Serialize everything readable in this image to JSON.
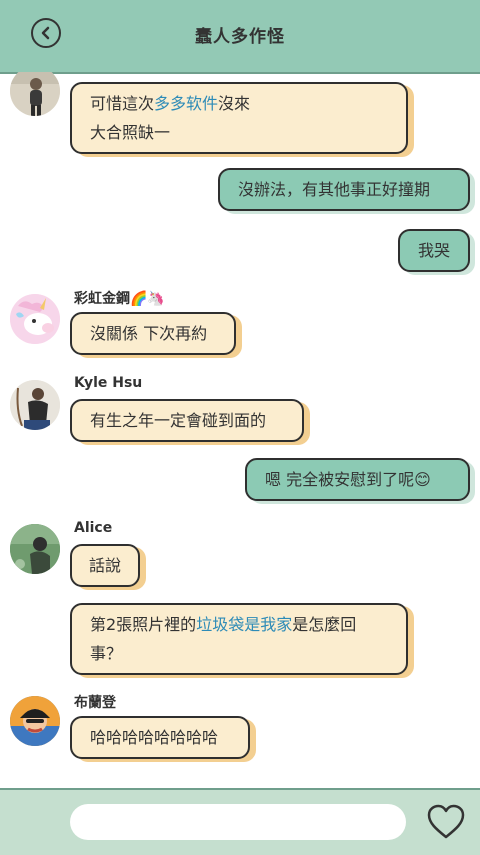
{
  "header": {
    "title": "蠢人多作怪",
    "back_icon": "chevron-left-icon"
  },
  "messages": [
    {
      "sender": "",
      "avatar": "person-photo-avatar",
      "lines": [
        "可惜這次",
        "多多软件",
        "沒來",
        "大合照缺一"
      ]
    },
    {
      "outgoing": true,
      "text": "沒辦法，有其他事正好撞期"
    },
    {
      "outgoing": true,
      "text": "我哭"
    },
    {
      "sender": "彩虹金鋼🌈🦄",
      "avatar": "unicorn-avatar",
      "text": "沒關係 下次再約"
    },
    {
      "sender": "Kyle Hsu",
      "avatar": "person-photo-avatar",
      "text": "有生之年一定會碰到面的"
    },
    {
      "outgoing": true,
      "text": "嗯 完全被安慰到了呢😊"
    },
    {
      "sender": "Alice",
      "avatar": "person-photo-avatar",
      "text": "話說"
    },
    {
      "lines": [
        "第2張照片裡的",
        "垃圾袋是我家",
        "是怎麼回",
        "事？"
      ]
    },
    {
      "sender": "布蘭登",
      "avatar": "cartoon-avatar",
      "text": "哈哈哈哈哈哈哈哈"
    }
  ],
  "footer": {
    "input_value": "",
    "like_icon": "heart-icon"
  }
}
